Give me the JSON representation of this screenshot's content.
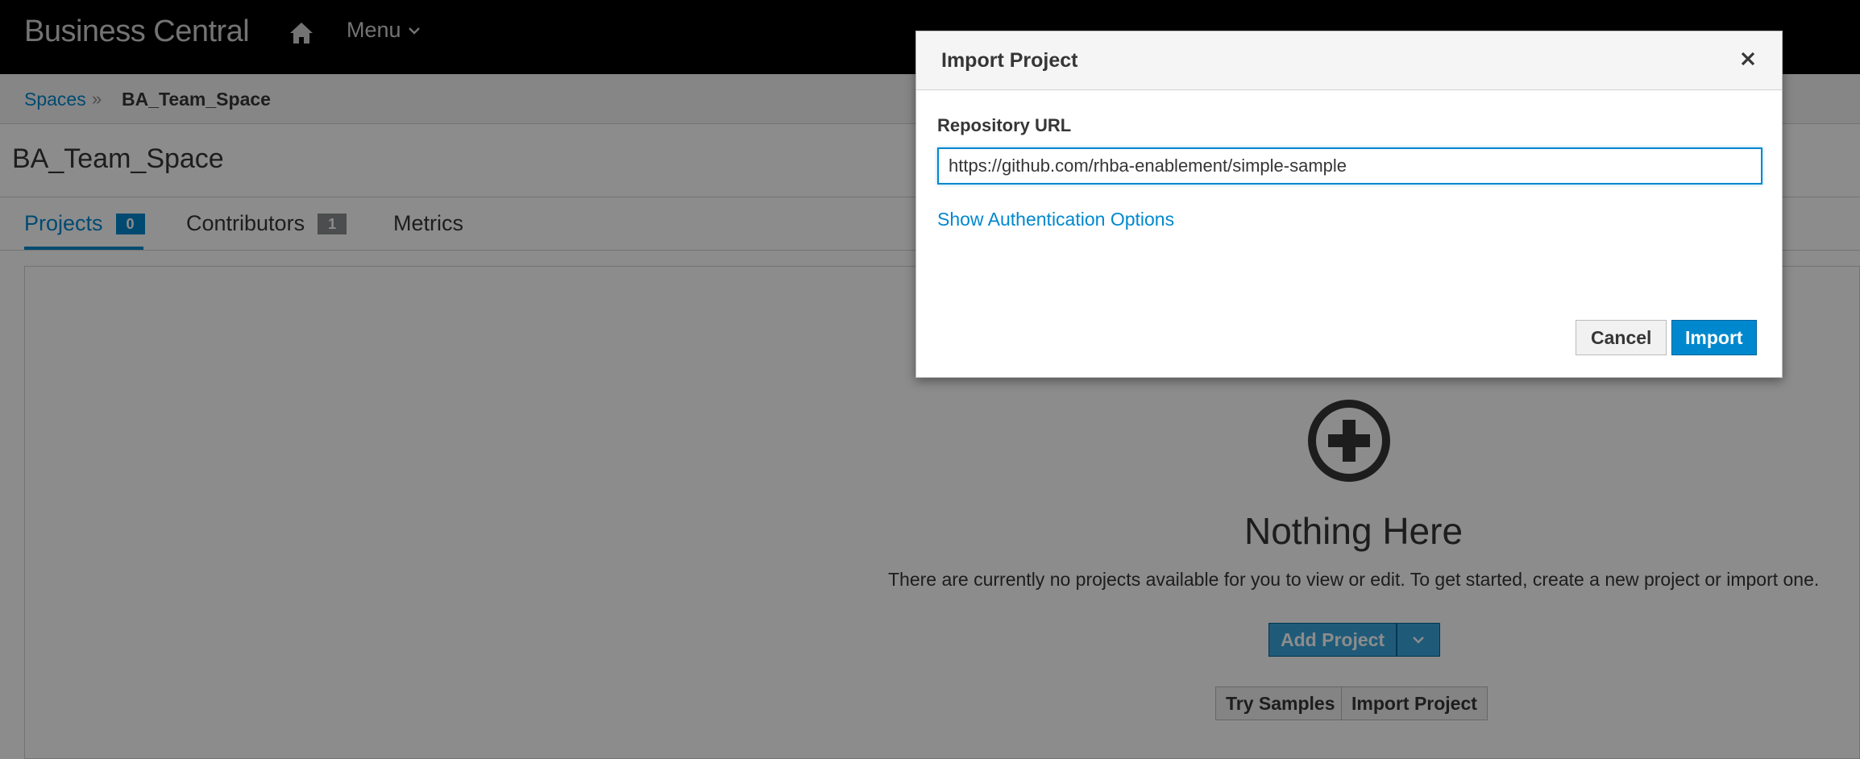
{
  "navbar": {
    "brand": "Business Central",
    "home_icon": "home-icon",
    "menu_label": "Menu",
    "menu_icon": "chevron-down-icon"
  },
  "breadcrumb": {
    "root": "Spaces",
    "separator": "»",
    "current": "BA_Team_Space"
  },
  "page": {
    "title": "BA_Team_Space"
  },
  "tabs": [
    {
      "label": "Projects",
      "count": "0",
      "active": true
    },
    {
      "label": "Contributors",
      "count": "1",
      "active": false
    },
    {
      "label": "Metrics",
      "active": false
    }
  ],
  "empty_state": {
    "icon": "plus-circle-icon",
    "title": "Nothing Here",
    "message": "There are currently no projects available for you to view or edit. To get started, create a new project or import one.",
    "add_project_label": "Add Project",
    "try_samples_label": "Try Samples",
    "import_project_label": "Import Project"
  },
  "modal": {
    "title": "Import Project",
    "close_icon": "close-icon",
    "repo_label": "Repository URL",
    "repo_value": "https://github.com/rhba-enablement/simple-sample",
    "auth_link": "Show Authentication Options",
    "cancel_label": "Cancel",
    "import_label": "Import"
  },
  "colors": {
    "navbar_bg": "#000000",
    "accent": "#0088ce",
    "primary_button": "#39a5dc"
  }
}
